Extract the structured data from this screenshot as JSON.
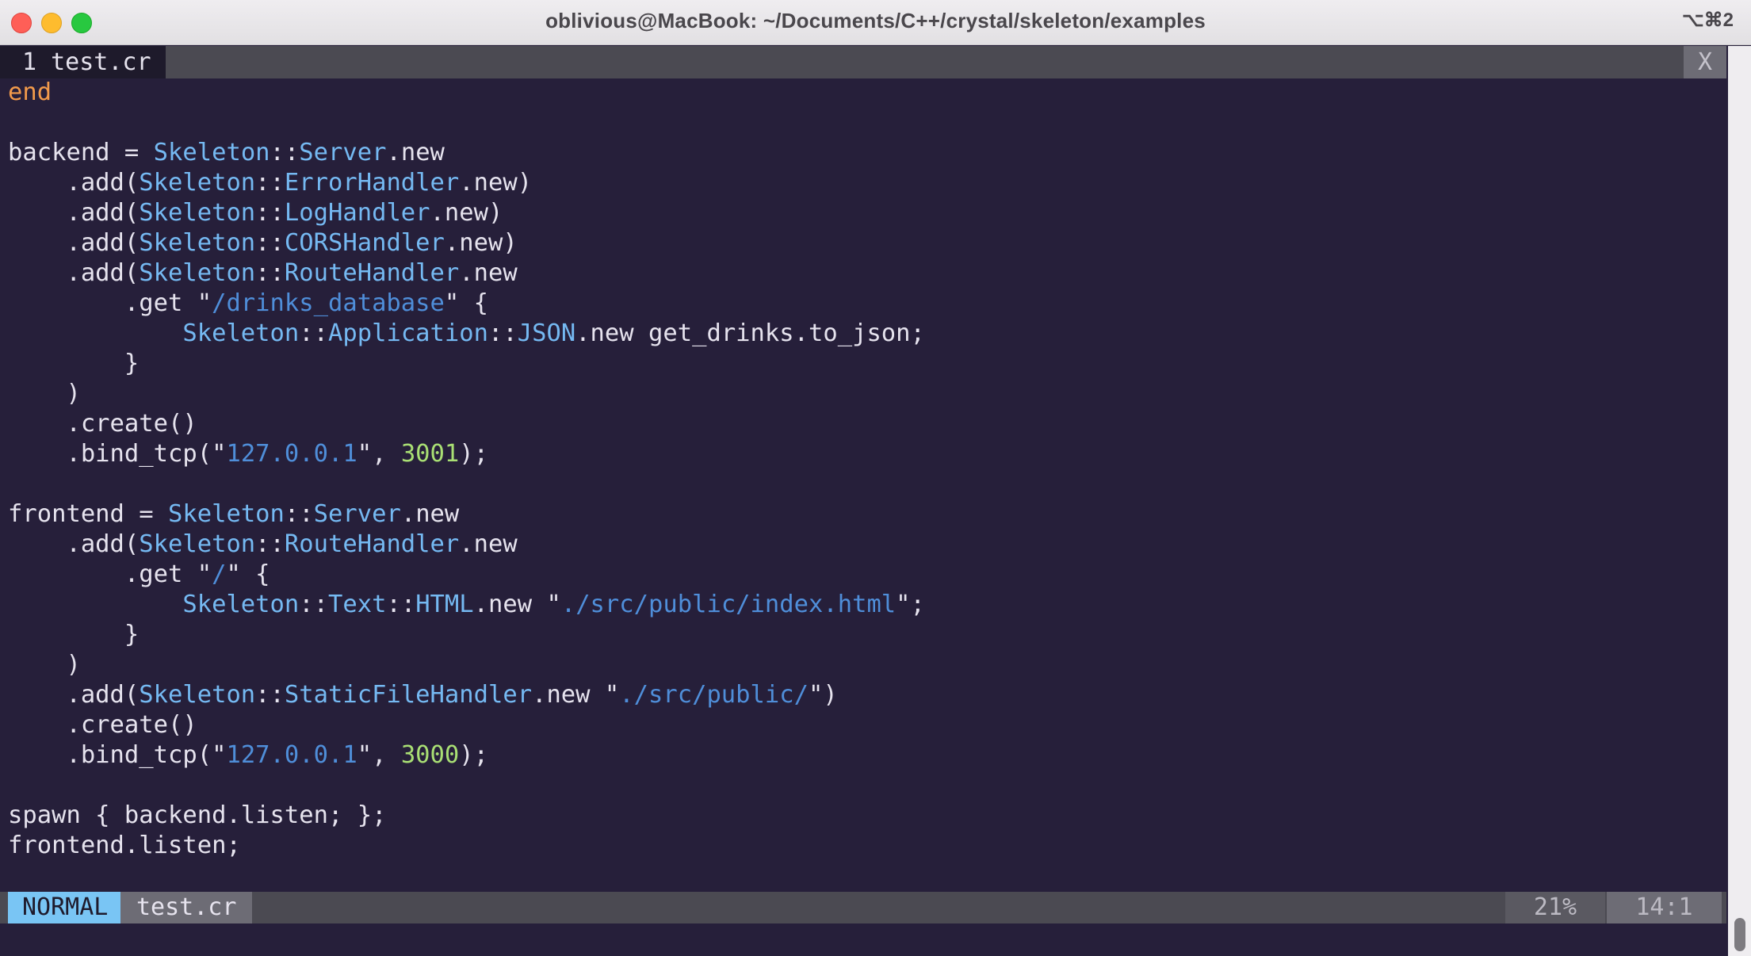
{
  "window": {
    "title": "oblivious@MacBook: ~/Documents/C++/crystal/skeleton/examples",
    "shortcut": "⌥⌘2",
    "traffic_lights": [
      "close",
      "minimize",
      "zoom"
    ]
  },
  "tabline": {
    "active_tab": "1 test.cr",
    "close_label": "X"
  },
  "colors": {
    "background": "#261f3a",
    "keyword": "#f29a4b",
    "type": "#75b9f2",
    "string": "#4f8ed9",
    "number": "#a9df74",
    "text": "#e6e3ee"
  },
  "code": [
    [
      {
        "t": "end",
        "c": "kw"
      }
    ],
    [],
    [
      {
        "t": "backend = "
      },
      {
        "t": "Skeleton",
        "c": "ty"
      },
      {
        "t": "::"
      },
      {
        "t": "Server",
        "c": "ty"
      },
      {
        "t": ".new"
      }
    ],
    [
      {
        "t": "    .add("
      },
      {
        "t": "Skeleton",
        "c": "ty"
      },
      {
        "t": "::"
      },
      {
        "t": "ErrorHandler",
        "c": "ty"
      },
      {
        "t": ".new)"
      }
    ],
    [
      {
        "t": "    .add("
      },
      {
        "t": "Skeleton",
        "c": "ty"
      },
      {
        "t": "::"
      },
      {
        "t": "LogHandler",
        "c": "ty"
      },
      {
        "t": ".new)"
      }
    ],
    [
      {
        "t": "    .add("
      },
      {
        "t": "Skeleton",
        "c": "ty"
      },
      {
        "t": "::"
      },
      {
        "t": "CORSHandler",
        "c": "ty"
      },
      {
        "t": ".new)"
      }
    ],
    [
      {
        "t": "    .add("
      },
      {
        "t": "Skeleton",
        "c": "ty"
      },
      {
        "t": "::"
      },
      {
        "t": "RouteHandler",
        "c": "ty"
      },
      {
        "t": ".new"
      }
    ],
    [
      {
        "t": "        .get \""
      },
      {
        "t": "/drinks_database",
        "c": "str"
      },
      {
        "t": "\" {"
      }
    ],
    [
      {
        "t": "            "
      },
      {
        "t": "Skeleton",
        "c": "ty"
      },
      {
        "t": "::"
      },
      {
        "t": "Application",
        "c": "ty"
      },
      {
        "t": "::"
      },
      {
        "t": "JSON",
        "c": "ty"
      },
      {
        "t": ".new get_drinks.to_json;"
      }
    ],
    [
      {
        "t": "        }"
      }
    ],
    [
      {
        "t": "    )"
      }
    ],
    [
      {
        "t": "    .create()"
      }
    ],
    [
      {
        "t": "    .bind_tcp(\""
      },
      {
        "t": "127.0.0.1",
        "c": "str"
      },
      {
        "t": "\", "
      },
      {
        "t": "3001",
        "c": "num"
      },
      {
        "t": ");"
      }
    ],
    [],
    [
      {
        "t": "frontend = "
      },
      {
        "t": "Skeleton",
        "c": "ty"
      },
      {
        "t": "::"
      },
      {
        "t": "Server",
        "c": "ty"
      },
      {
        "t": ".new"
      }
    ],
    [
      {
        "t": "    .add("
      },
      {
        "t": "Skeleton",
        "c": "ty"
      },
      {
        "t": "::"
      },
      {
        "t": "RouteHandler",
        "c": "ty"
      },
      {
        "t": ".new"
      }
    ],
    [
      {
        "t": "        .get \""
      },
      {
        "t": "/",
        "c": "str"
      },
      {
        "t": "\" {"
      }
    ],
    [
      {
        "t": "            "
      },
      {
        "t": "Skeleton",
        "c": "ty"
      },
      {
        "t": "::"
      },
      {
        "t": "Text",
        "c": "ty"
      },
      {
        "t": "::"
      },
      {
        "t": "HTML",
        "c": "ty"
      },
      {
        "t": ".new \""
      },
      {
        "t": "./src/public/index.html",
        "c": "str"
      },
      {
        "t": "\";"
      }
    ],
    [
      {
        "t": "        }"
      }
    ],
    [
      {
        "t": "    )"
      }
    ],
    [
      {
        "t": "    .add("
      },
      {
        "t": "Skeleton",
        "c": "ty"
      },
      {
        "t": "::"
      },
      {
        "t": "StaticFileHandler",
        "c": "ty"
      },
      {
        "t": ".new \""
      },
      {
        "t": "./src/public/",
        "c": "str"
      },
      {
        "t": "\")"
      }
    ],
    [
      {
        "t": "    .create()"
      }
    ],
    [
      {
        "t": "    .bind_tcp(\""
      },
      {
        "t": "127.0.0.1",
        "c": "str"
      },
      {
        "t": "\", "
      },
      {
        "t": "3000",
        "c": "num"
      },
      {
        "t": ");"
      }
    ],
    [],
    [
      {
        "t": "spawn { backend.listen; };"
      }
    ],
    [
      {
        "t": "frontend.listen;"
      }
    ]
  ],
  "statusline": {
    "mode": "NORMAL",
    "filename": "test.cr",
    "percent": "21%",
    "position": "14:1"
  }
}
